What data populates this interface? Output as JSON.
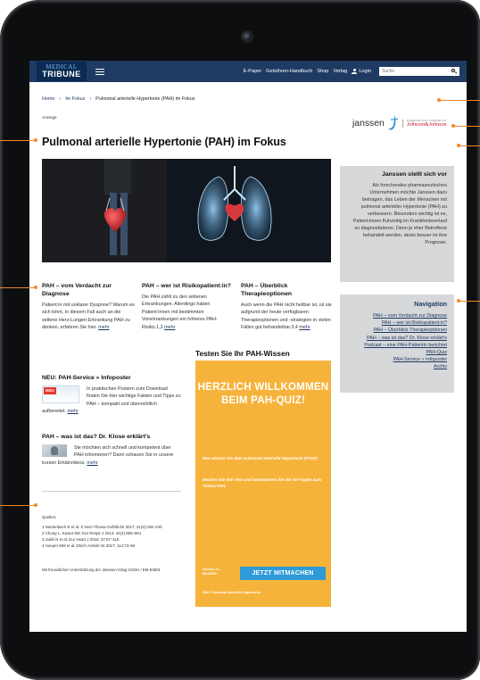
{
  "navbar": {
    "logo_line1": "MEDICAL",
    "logo_line2": "TRIBUNE",
    "links": [
      "E-Paper",
      "Gebühren-Handbuch",
      "Shop",
      "Verlag"
    ],
    "login_label": "Login",
    "search_placeholder": "Suche"
  },
  "breadcrumb": {
    "home": "Home",
    "section": "Im Fokus",
    "current": "Pulmonal arterielle Hypertonie (PAH) im Fokus"
  },
  "anzeige": "Anzeige",
  "page_title": "Pulmonal arterielle Hypertonie (PAH) im Fokus",
  "brand": {
    "janssen": "janssen",
    "jj_small": "PHARMACEUTICAL COMPANIES OF",
    "jj": "Johnson&Johnson"
  },
  "sidebar": {
    "intro_title": "Janssen stellt sich vor",
    "intro_text": "Als forschendes pharmazeutisches Unternehmen möchte Janssen dazu beitragen, das Leben der Menschen mit pulmonal arterieller Hypertonie (PAH) zu verbessern. Besonders wichtig ist es, Patient:innen frühzeitig im Krankheitsverlauf zu diagnostizieren. Denn je eher Betroffene behandelt werden, desto besser ist ihre Prognose.",
    "nav_title": "Navigation",
    "nav_links": [
      "PAH – vom Verdacht zur Diagnose",
      "PAH – wer ist Risikopatient:in?",
      "PAH – Überblick Therapieoptionen",
      "PAH – was ist das? Dr. Klose erklärt's",
      "Podcast – eine PAH-Patientin berichtet",
      "PAH-Quiz",
      "PAH-Service » Infoposter",
      "Archiv"
    ]
  },
  "columns": [
    {
      "title": "PAH – vom Verdacht zur Diagnose",
      "text": "Patient:in mit unklarer Dyspnoe? Warum es sich lohnt, in diesem Fall auch an die seltene Herz-Lungen-Erkrankung PAH zu denken, erfahren Sie hier.",
      "link": "mehr"
    },
    {
      "title": "PAH – wer ist Risikopatient:in?",
      "text": "Die PAH zählt zu den seltenen Erkrankungen. Allerdings haben Patient:innen mit bestimmten Vorerkrankungen ein höheres PAH-Risiko.1,2",
      "link": "mehr"
    },
    {
      "title": "PAH – Überblick Therapieoptionen",
      "text": "Auch wenn die PAH nicht heilbar ist, ist sie aufgrund der heute verfügbaren Therapieoptionen und -strategien in vielen Fällen gut behandelbar.3,4",
      "link": "mehr"
    }
  ],
  "infoposter": {
    "title": "NEU: PAH-Service » Infoposter",
    "badge": "NEU",
    "text": "In praktischen Postern zum Download finden Sie hier wichtige Fakten und Tipps zu PAH – kompakt und übersichtlich aufbereitet.",
    "link": "mehr"
  },
  "klose": {
    "title": "PAH – was ist das? Dr. Klose erklärt's",
    "text": "Sie möchten sich schnell und kompetent über PAH informieren? Dann schauen Sie in unsere kurzen Erklärvideos.",
    "link": "mehr"
  },
  "quellen": {
    "title": "Quellen:",
    "items": [
      "1 Neidenbach R et al. Z Herz-Thorax-Gefäßchir 2017; 31(4):228–240",
      "2 Chung L, Kawut SM. Eur Respir J 2014; 44(4):859–861",
      "3 Galiè N et al. Eur Heart J 2016; 37:67–119",
      "4 Hoeper MM et al. Dtsch Arztebl Int 2017; 114:73–84"
    ]
  },
  "support": "Mit freundlicher Unterstützung der Janssen-Cilag GmbH / EM-63801",
  "quiz": {
    "heading": "Testen Sie Ihr PAH-Wissen",
    "title": "HERZLICH WILLKOMMEN BEIM PAH-QUIZ!",
    "q1": "Was wissen Sie über pulmonal arterielle Hypertonie (PAH)?",
    "q2": "Machen Sie den Test und beantworten Sie die 10 Fragen zum Thema PAH.",
    "button": "JETZT MITMACHEN",
    "foot1": "Janssen-Ci...",
    "foot1b": "EM-68000",
    "foot2": "PAH: Pulmonal arterielle Hypertonie."
  },
  "colors": {
    "navbar": "#1f3b63",
    "quiz_bg": "#f6b33b",
    "quiz_button": "#2f9ad8",
    "sidebar_box": "#d6d8da",
    "callout": "#f08a28"
  }
}
